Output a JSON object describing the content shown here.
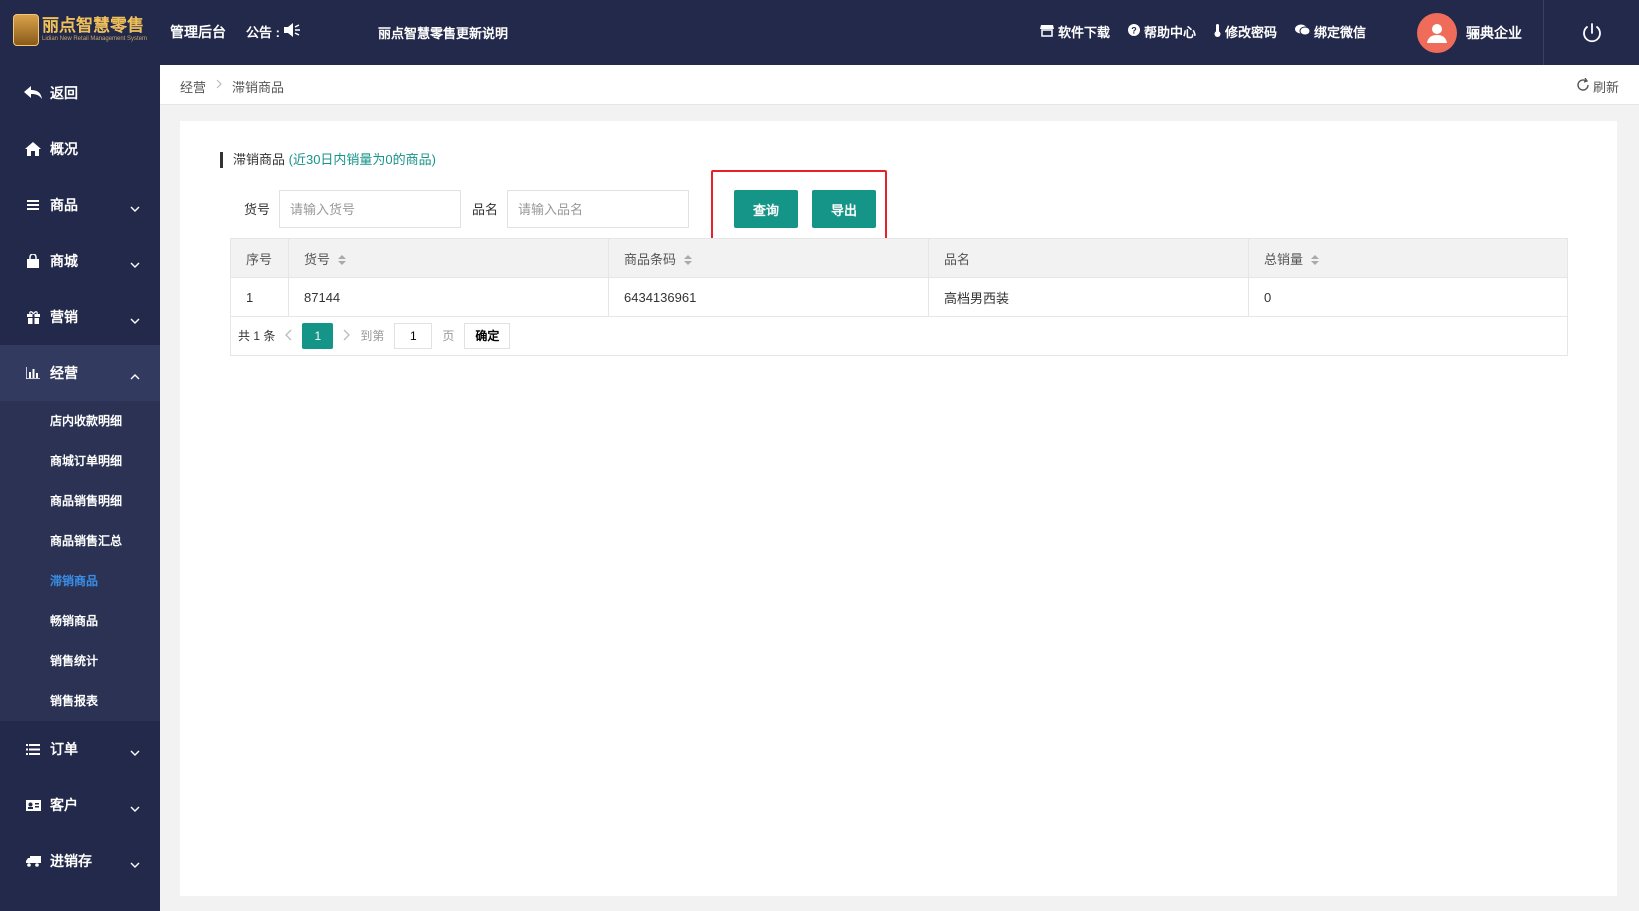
{
  "header": {
    "logo_title": "丽点智慧零售",
    "logo_subtitle": "Lidian New Retail Management System",
    "admin_label": "管理后台",
    "notice_label": "公告 :",
    "notice_text": "丽点智慧零售更新说明",
    "links": [
      "软件下载",
      "帮助中心",
      "修改密码",
      "绑定微信"
    ],
    "company": "骊典企业"
  },
  "sidebar": {
    "items": [
      {
        "label": "返回",
        "icon": "back-arrow-icon"
      },
      {
        "label": "概况",
        "icon": "home-icon"
      },
      {
        "label": "商品",
        "icon": "list-icon"
      },
      {
        "label": "商城",
        "icon": "bag-icon"
      },
      {
        "label": "营销",
        "icon": "gift-icon"
      },
      {
        "label": "经营",
        "icon": "bar-chart-icon"
      },
      {
        "label": "订单",
        "icon": "list-icon"
      },
      {
        "label": "客户",
        "icon": "id-card-icon"
      },
      {
        "label": "进销存",
        "icon": "truck-icon"
      }
    ],
    "sub_items": [
      "店内收款明细",
      "商城订单明细",
      "商品销售明细",
      "商品销售汇总",
      "滞销商品",
      "畅销商品",
      "销售统计",
      "销售报表"
    ]
  },
  "breadcrumb": {
    "parent": "经营",
    "current": "滞销商品",
    "refresh": "刷新"
  },
  "main": {
    "title": "滞销商品",
    "hint": "(近30日内销量为0的商品)",
    "filters": {
      "sku_label": "货号",
      "sku_placeholder": "请输入货号",
      "name_label": "品名",
      "name_placeholder": "请输入品名"
    },
    "buttons": {
      "query": "查询",
      "export": "导出"
    },
    "table": {
      "columns": [
        "序号",
        "货号",
        "商品条码",
        "品名",
        "总销量"
      ],
      "rows": [
        [
          "1",
          "87144",
          "6434136961",
          "高档男西装",
          "0"
        ]
      ]
    },
    "pager": {
      "total": "共 1 条",
      "current_page": "1",
      "goto_label": "到第",
      "goto_value": "1",
      "page_unit": "页",
      "confirm": "确定"
    }
  },
  "colors": {
    "nav_bg": "#23294a",
    "accent": "#159488",
    "highlight_box": "#e62129",
    "active_sub": "#3a8ee6"
  }
}
